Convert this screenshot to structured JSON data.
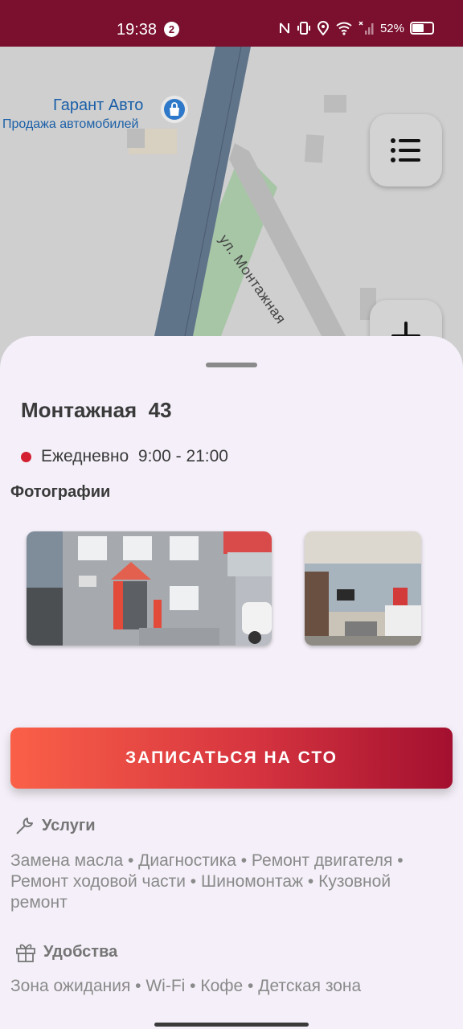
{
  "status_bar": {
    "time": "19:38",
    "notification_count": "2",
    "battery": "52%"
  },
  "map": {
    "poi_title": "Гарант Авто",
    "poi_subtitle": "Продажа автомобилей",
    "street_label": "ул. Монтажная",
    "icons": [
      "list-icon",
      "plus-icon",
      "shopping-bag-pin-icon"
    ]
  },
  "place": {
    "title": "Монтажная  43",
    "hours": "Ежедневно  9:00 - 21:00",
    "status_color": "#d31f2f"
  },
  "photos": {
    "label": "Фотографии"
  },
  "cta": {
    "label": "ЗАПИСАТЬСЯ НА СТО"
  },
  "services": {
    "label": "Услуги",
    "text": "Замена масла • Диагностика • Ремонт двигателя • Ремонт ходовой части • Шиномонтаж • Кузовной ремонт"
  },
  "amenities": {
    "label": "Удобства",
    "text": "Зона ожидания • Wi-Fi • Кофе • Детская зона"
  },
  "colors": {
    "status_bar": "#7a0f2e",
    "cta_start": "#fa6048",
    "cta_end": "#a3102f",
    "sheet_bg": "#f4eff8"
  }
}
